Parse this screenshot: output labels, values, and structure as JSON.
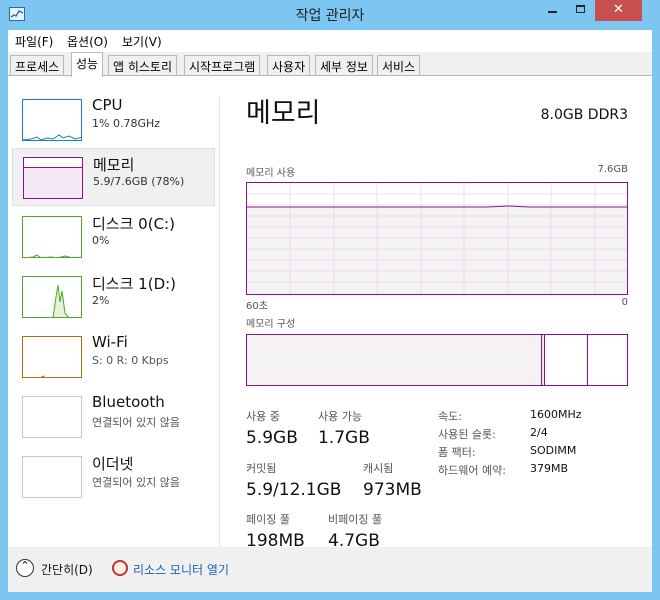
{
  "window": {
    "title": "작업 관리자",
    "close_glyph": "✕",
    "icons": {
      "app": "task-manager-icon",
      "min": "minimize-icon",
      "max": "maximize-icon",
      "close": "close-icon"
    }
  },
  "menu": [
    "파일(F)",
    "옵션(O)",
    "보기(V)"
  ],
  "tabs": [
    "프로세스",
    "성능",
    "앱 히스토리",
    "시작프로그램",
    "사용자",
    "세부 정보",
    "서비스"
  ],
  "active_tab": "성능",
  "sidebar": [
    {
      "title": "CPU",
      "sub": "1% 0.78GHz",
      "color": "#1a7fc1",
      "icon": "cpu-graph"
    },
    {
      "title": "메모리",
      "sub": "5.9/7.6GB (78%)",
      "color": "#8b128b",
      "icon": "memory-graph",
      "selected": true
    },
    {
      "title": "디스크 0(C:)",
      "sub": "0%",
      "color": "#4da82b",
      "icon": "disk-graph"
    },
    {
      "title": "디스크 1(D:)",
      "sub": "2%",
      "color": "#4da82b",
      "icon": "disk-graph"
    },
    {
      "title": "Wi-Fi",
      "sub": "S: 0  R: 0 Kbps",
      "color": "#a7720d",
      "icon": "network-graph"
    },
    {
      "title": "Bluetooth",
      "sub": "연결되어 있지 않음",
      "color": "#999999",
      "icon": "network-graph"
    },
    {
      "title": "이더넷",
      "sub": "연결되어 있지 않음",
      "color": "#999999",
      "icon": "network-graph"
    }
  ],
  "main": {
    "title": "메모리",
    "spec": "8.0GB DDR3",
    "usage_label": "메모리 사용",
    "usage_max": "7.6GB",
    "time_left": "60초",
    "time_right": "0",
    "composition_label": "메모리 구성",
    "usage_fraction": 0.78,
    "accent_color": "#8b128b"
  },
  "stats": {
    "in_use_label": "사용 중",
    "in_use": "5.9GB",
    "available_label": "사용 가능",
    "available": "1.7GB",
    "committed_label": "커밋됨",
    "committed": "5.9/12.1GB",
    "cached_label": "캐시됨",
    "cached": "973MB",
    "paged_label": "페이징 풀",
    "paged": "198MB",
    "nonpaged_label": "비페이징 풀",
    "nonpaged": "4.7GB"
  },
  "specs": [
    {
      "key": "속도:",
      "value": "1600MHz"
    },
    {
      "key": "사용된 슬롯:",
      "value": "2/4"
    },
    {
      "key": "폼 팩터:",
      "value": "SODIMM"
    },
    {
      "key": "하드웨어 예약:",
      "value": "379MB"
    }
  ],
  "footer": {
    "collapse": "간단히(D)",
    "resource_monitor": "리소스 모니터 열기",
    "icons": {
      "collapse": "chevron-up-icon",
      "resource_monitor": "resource-monitor-icon"
    }
  }
}
